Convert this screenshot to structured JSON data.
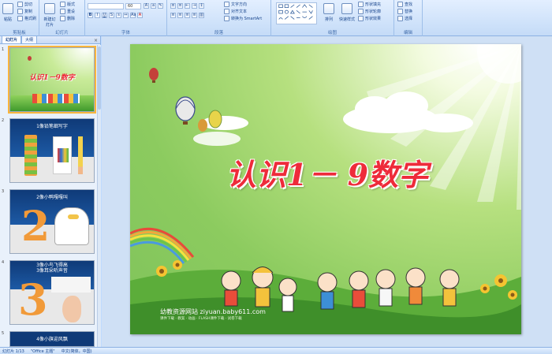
{
  "ribbon": {
    "groups": [
      {
        "label": "剪贴板"
      },
      {
        "label": "幻灯片"
      },
      {
        "label": "字体"
      },
      {
        "label": "段落"
      },
      {
        "label": "绘图"
      },
      {
        "label": "编辑"
      }
    ],
    "clipboard": {
      "paste": "粘贴",
      "cut": "剪切",
      "copy": "复制",
      "format_painter": "格式刷"
    },
    "slides": {
      "new_slide": "新建幻灯片",
      "layout": "版式",
      "reset": "重设",
      "delete": "删除"
    },
    "font": {
      "font_size": "60"
    },
    "paragraph": {
      "text_direction": "文字方向",
      "align_text": "对齐文本",
      "smartart": "转换为 SmartArt"
    },
    "drawing": {
      "arrange": "排列",
      "quick_styles": "快速样式",
      "shape_fill": "形状填充",
      "shape_outline": "形状轮廓",
      "shape_effects": "形状效果"
    },
    "editing": {
      "find": "查找",
      "replace": "替换",
      "select": "选择"
    }
  },
  "panel": {
    "tabs": [
      "幻灯片",
      "大纲"
    ],
    "close": "×",
    "thumbnails": [
      {
        "number": "1",
        "caption": "认识1－9数字"
      },
      {
        "number": "2",
        "caption": "1像铅笔细写字"
      },
      {
        "number": "3",
        "caption": "2像小鸭嘎嘎叫"
      },
      {
        "number": "4",
        "caption": "3像小鸟飞得高\n3像耳朵听声音"
      },
      {
        "number": "5",
        "caption": "4像小旗迎风飘"
      }
    ]
  },
  "slide": {
    "title": "认识1－ 9数字",
    "watermark": "幼教资源网站  ziyuan.baby611.com",
    "watermark_sub": "课件下载 · 教案 · 动画 · FLASH课件下载 · 试卷下载"
  },
  "status": {
    "slide_count": "幻灯片 1/13",
    "theme": "\"Office 主题\"",
    "language": "中文(简体，中国)"
  },
  "colors": {
    "accent": "#ee2b3a",
    "ribbon": "#c4dbf7",
    "grass": "#7fc35b"
  }
}
